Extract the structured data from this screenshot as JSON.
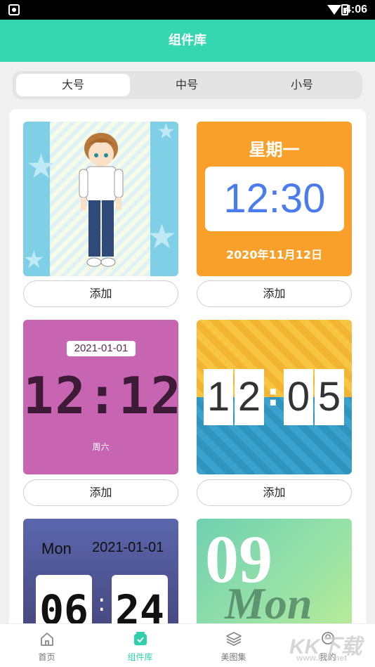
{
  "status_bar": {
    "time": "4:06"
  },
  "header": {
    "title": "组件库"
  },
  "size_tabs": [
    {
      "label": "大号",
      "active": true
    },
    {
      "label": "中号",
      "active": false
    },
    {
      "label": "小号",
      "active": false
    }
  ],
  "widgets": {
    "w1": {
      "add_label": "添加"
    },
    "w2": {
      "weekday": "星期一",
      "time": "12:30",
      "date": "2020年11月12日",
      "add_label": "添加"
    },
    "w3": {
      "date": "2021-01-01",
      "time": "12:12",
      "weekday": "周六",
      "add_label": "添加"
    },
    "w4": {
      "h1": "1",
      "h2": "2",
      "m1": "0",
      "m2": "5",
      "colon": ":",
      "add_label": "添加"
    },
    "w5": {
      "day": "Mon",
      "date": "2021-01-01",
      "hour": "06",
      "minute": "24",
      "colon": ":"
    },
    "w6": {
      "day_number": "09",
      "day": "Mon"
    }
  },
  "bottom_nav": [
    {
      "label": "首页",
      "icon": "home-icon",
      "active": false
    },
    {
      "label": "组件库",
      "icon": "widget-icon",
      "active": true
    },
    {
      "label": "美图集",
      "icon": "layers-icon",
      "active": false
    },
    {
      "label": "我的",
      "icon": "profile-icon",
      "active": false
    }
  ],
  "watermark": {
    "text": "KK下载",
    "url": "www.kkx.net"
  },
  "colors": {
    "accent": "#35d7b0",
    "orange": "#f9a02a",
    "pink": "#c865b3"
  }
}
